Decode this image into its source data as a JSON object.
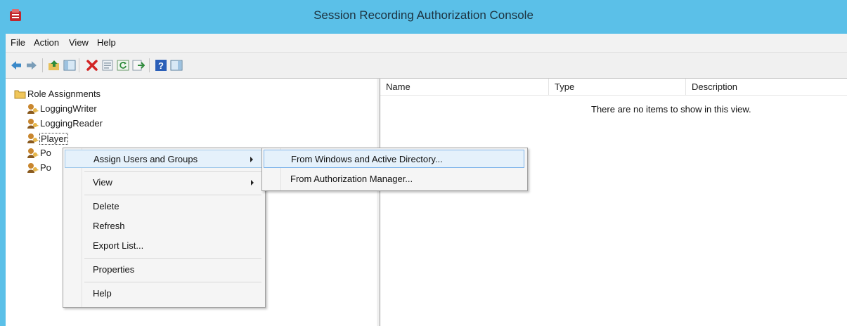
{
  "window": {
    "title": "Session Recording Authorization Console",
    "accent": "#5bc0e8"
  },
  "menubar": {
    "items": [
      {
        "label": "File",
        "icon": ""
      },
      {
        "label": "Action"
      },
      {
        "label": "View"
      },
      {
        "label": "Help"
      }
    ]
  },
  "toolbar": {
    "buttons": [
      "back-icon",
      "forward-icon",
      "up-folder-icon",
      "show-hide-tree-icon",
      "delete-icon",
      "properties-icon",
      "refresh-icon",
      "export-list-icon",
      "help-icon",
      "show-hide-action-pane-icon"
    ]
  },
  "tree": {
    "root": "Role Assignments",
    "roles": [
      "LoggingWriter",
      "LoggingReader",
      "Player",
      "Po",
      "Po"
    ]
  },
  "list": {
    "columns": [
      "Name",
      "Type",
      "Description"
    ],
    "empty_message": "There are no items to show in this view."
  },
  "context_menu": {
    "items": [
      {
        "label": "Assign Users and Groups",
        "submenu": true
      },
      {
        "label": "View",
        "submenu": true
      },
      {
        "label": "Delete"
      },
      {
        "label": "Refresh"
      },
      {
        "label": "Export List..."
      },
      {
        "label": "Properties"
      },
      {
        "label": "Help"
      }
    ],
    "submenu": [
      {
        "label": "From Windows and Active Directory..."
      },
      {
        "label": "From Authorization Manager..."
      }
    ]
  }
}
